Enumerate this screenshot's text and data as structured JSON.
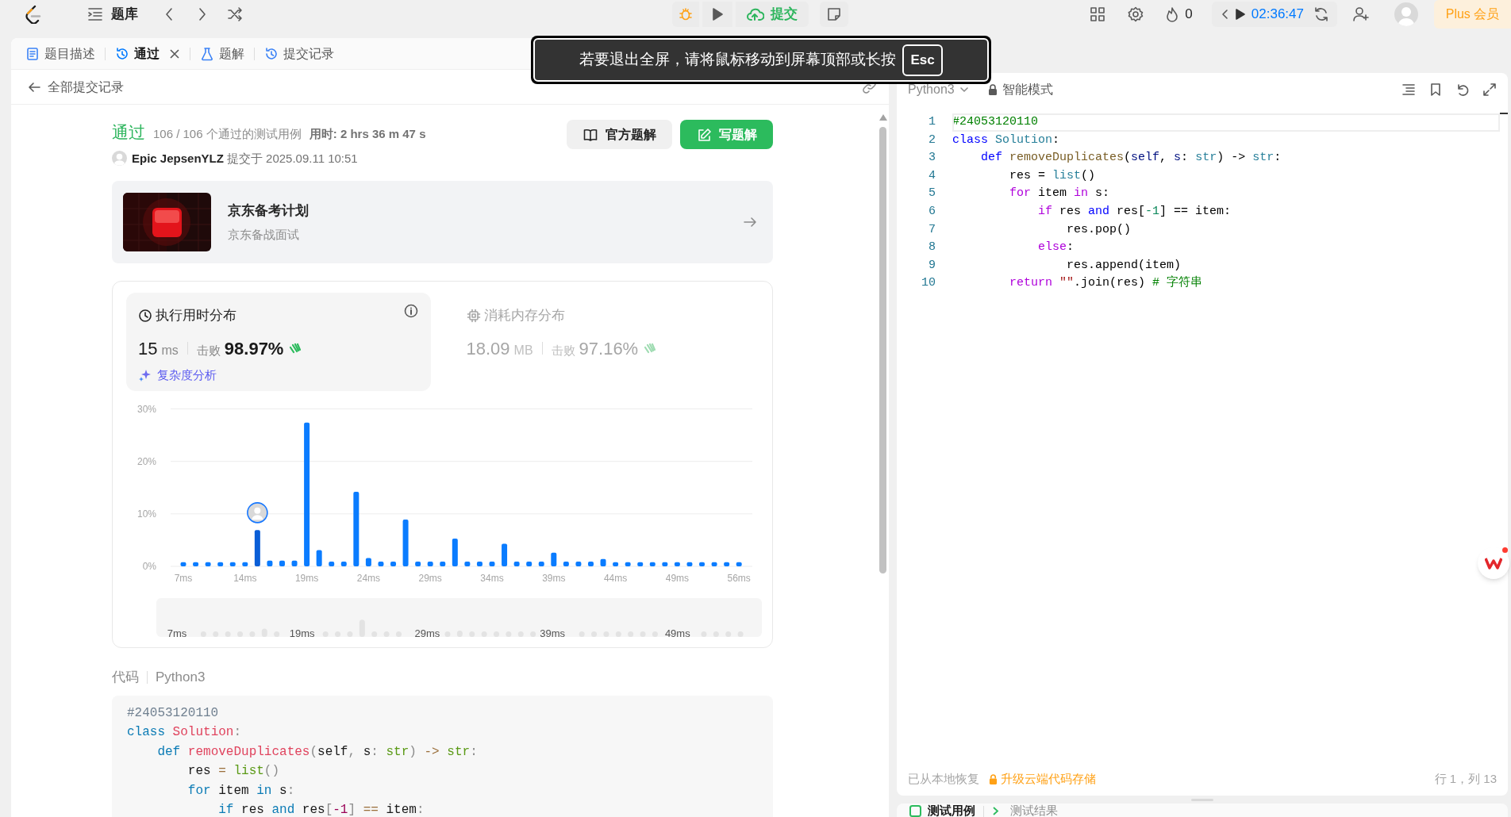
{
  "top_bar": {
    "problem_bank": "题库",
    "submit": "提交",
    "streak": "0",
    "timer": "02:36:47",
    "plus": "Plus 会员"
  },
  "fullscreen_toast": {
    "message": "若要退出全屏，请将鼠标移动到屏幕顶部或长按",
    "key": "Esc"
  },
  "left_tabs": [
    {
      "label": "题目描述",
      "selected": false,
      "closable": false,
      "kind": "description"
    },
    {
      "label": "通过",
      "selected": true,
      "closable": true,
      "kind": "result"
    },
    {
      "label": "题解",
      "selected": false,
      "closable": false,
      "kind": "solutions"
    },
    {
      "label": "提交记录",
      "selected": false,
      "closable": false,
      "kind": "history"
    }
  ],
  "back_link": "全部提交记录",
  "submission": {
    "status": "通过",
    "cases": "106 / 106 个通过的测试用例",
    "time_label": "用时: 2 hrs 36 m 47 s",
    "user": "Epic JepsenYLZ",
    "submitted": "提交于 2025.09.11 10:51",
    "buttons": [
      {
        "label": "官方题解",
        "kind": "secondary"
      },
      {
        "label": "写题解",
        "kind": "primary"
      }
    ]
  },
  "promo": {
    "title": "京东备考计划",
    "subtitle": "京东备战面试"
  },
  "stats": [
    {
      "kind": "runtime",
      "title": "执行用时分布",
      "value": "15",
      "unit": "ms",
      "beat_label": "击败",
      "beat": "98.97%",
      "selected": true,
      "link": "复杂度分析"
    },
    {
      "kind": "memory",
      "title": "消耗内存分布",
      "value": "18.09",
      "unit": "MB",
      "beat_label": "击败",
      "beat": "97.16%",
      "selected": false
    }
  ],
  "chart_data": {
    "type": "bar",
    "categories": [
      "7ms",
      null,
      null,
      null,
      null,
      "14ms",
      null,
      null,
      null,
      null,
      "19ms",
      null,
      null,
      null,
      null,
      "24ms",
      null,
      null,
      null,
      null,
      "29ms",
      null,
      null,
      null,
      null,
      "34ms",
      null,
      null,
      null,
      null,
      "39ms",
      null,
      null,
      null,
      null,
      "44ms",
      null,
      null,
      null,
      null,
      "49ms",
      null,
      null,
      null,
      null,
      "56ms"
    ],
    "stacked": true,
    "series": [
      {
        "color": "#0a7cff",
        "values": [
          0.8,
          0.8,
          0.8,
          0.8,
          0.8,
          0.8,
          null,
          1.1,
          1.1,
          1.1,
          27.4,
          3.1,
          0.9,
          0.9,
          14.2,
          1.6,
          0.9,
          0.9,
          8.9,
          0.9,
          0.9,
          0.9,
          5.3,
          0.9,
          0.9,
          0.9,
          4.3,
          0.9,
          0.9,
          0.9,
          2.6,
          0.9,
          0.9,
          0.9,
          1.4,
          0.8,
          0.8,
          0.8,
          0.8,
          0.8,
          0.8,
          0.8,
          0.8,
          0.8,
          0.8,
          0.8
        ]
      },
      {
        "color": "#0a5ed7",
        "values": [
          null,
          null,
          null,
          null,
          null,
          null,
          6.9,
          null,
          null,
          null,
          null,
          null,
          null,
          null,
          null,
          null,
          null,
          null,
          null,
          null,
          null,
          null,
          null,
          null,
          null,
          null,
          null,
          null,
          null,
          null,
          null,
          null,
          null,
          null,
          null,
          null,
          null,
          null,
          null,
          null,
          null,
          null,
          null,
          null,
          null,
          null
        ]
      }
    ],
    "ylim": [
      0,
      30
    ],
    "yticks": [
      {
        "value": 0,
        "label": "0%"
      },
      {
        "value": 10,
        "label": "10%"
      },
      {
        "value": 20,
        "label": "20%"
      },
      {
        "value": 30,
        "label": "30%"
      }
    ]
  },
  "navigator_labels": [
    "7ms",
    "19ms",
    "29ms",
    "39ms",
    "49ms"
  ],
  "code": {
    "label": "代码",
    "language": "Python3",
    "lines": [
      [
        {
          "text": "#24053120110",
          "kind": "comment"
        }
      ],
      [
        {
          "text": "class",
          "kind": "keyword"
        },
        {
          "text": " Solution",
          "kind": "name"
        },
        {
          "text": ":",
          "kind": "punct"
        }
      ],
      [
        {
          "text": "    def",
          "kind": "keyword"
        },
        {
          "text": " removeDuplicates",
          "kind": "name"
        },
        {
          "text": "(",
          "kind": "punct"
        },
        {
          "text": "self",
          "kind": "plain"
        },
        {
          "text": ",",
          "kind": "punct"
        },
        {
          "text": " s",
          "kind": "plain"
        },
        {
          "text": ":",
          "kind": "punct"
        },
        {
          "text": " str",
          "kind": "builtin"
        },
        {
          "text": ")",
          "kind": "punct"
        },
        {
          "text": " ->",
          "kind": "operator"
        },
        {
          "text": " str",
          "kind": "builtin"
        },
        {
          "text": ":",
          "kind": "punct"
        }
      ],
      [
        {
          "text": "        res ",
          "kind": "plain"
        },
        {
          "text": "=",
          "kind": "operator"
        },
        {
          "text": " list",
          "kind": "builtin"
        },
        {
          "text": "()",
          "kind": "punct"
        }
      ],
      [
        {
          "text": "        for",
          "kind": "keyword"
        },
        {
          "text": " item ",
          "kind": "plain"
        },
        {
          "text": "in",
          "kind": "keyword"
        },
        {
          "text": " s",
          "kind": "plain"
        },
        {
          "text": ":",
          "kind": "punct"
        }
      ],
      [
        {
          "text": "            if",
          "kind": "keyword"
        },
        {
          "text": " res ",
          "kind": "plain"
        },
        {
          "text": "and",
          "kind": "keyword"
        },
        {
          "text": " res",
          "kind": "plain"
        },
        {
          "text": "[",
          "kind": "punct"
        },
        {
          "text": "-1",
          "kind": "number"
        },
        {
          "text": "]",
          "kind": "punct"
        },
        {
          "text": " ==",
          "kind": "operator"
        },
        {
          "text": " item",
          "kind": "plain"
        },
        {
          "text": ":",
          "kind": "punct"
        }
      ]
    ]
  },
  "editor": {
    "language": "Python3",
    "mode": "智能模式",
    "line_numbers": [
      "1",
      "2",
      "3",
      "4",
      "5",
      "6",
      "7",
      "8",
      "9",
      "10"
    ],
    "lines": [
      [
        {
          "text": "#24053120110",
          "kind": "comment"
        }
      ],
      [
        {
          "text": "class",
          "kind": "keyword"
        },
        {
          "text": " Solution",
          "kind": "type"
        },
        {
          "text": ":",
          "kind": "plain"
        }
      ],
      [
        {
          "text": "    def",
          "kind": "keyword"
        },
        {
          "text": " removeDuplicates",
          "kind": "function"
        },
        {
          "text": "(",
          "kind": "plain"
        },
        {
          "text": "self",
          "kind": "param"
        },
        {
          "text": ", ",
          "kind": "plain"
        },
        {
          "text": "s",
          "kind": "param"
        },
        {
          "text": ": ",
          "kind": "plain"
        },
        {
          "text": "str",
          "kind": "type"
        },
        {
          "text": ") -> ",
          "kind": "plain"
        },
        {
          "text": "str",
          "kind": "type"
        },
        {
          "text": ":",
          "kind": "plain"
        }
      ],
      [
        {
          "text": "        res = ",
          "kind": "plain"
        },
        {
          "text": "list",
          "kind": "type"
        },
        {
          "text": "()",
          "kind": "plain"
        }
      ],
      [
        {
          "text": "        for",
          "kind": "control"
        },
        {
          "text": " item ",
          "kind": "plain"
        },
        {
          "text": "in",
          "kind": "control"
        },
        {
          "text": " s:",
          "kind": "plain"
        }
      ],
      [
        {
          "text": "            if",
          "kind": "control"
        },
        {
          "text": " res ",
          "kind": "plain"
        },
        {
          "text": "and",
          "kind": "keyword"
        },
        {
          "text": " res[",
          "kind": "plain"
        },
        {
          "text": "-1",
          "kind": "number"
        },
        {
          "text": "] == item:",
          "kind": "plain"
        }
      ],
      [
        {
          "text": "                res.pop()",
          "kind": "plain"
        }
      ],
      [
        {
          "text": "            else",
          "kind": "control"
        },
        {
          "text": ":",
          "kind": "plain"
        }
      ],
      [
        {
          "text": "                res.append(item)",
          "kind": "plain"
        }
      ],
      [
        {
          "text": "        return",
          "kind": "control"
        },
        {
          "text": " \"\"",
          "kind": "string"
        },
        {
          "text": ".join(res) ",
          "kind": "plain"
        },
        {
          "text": "# 字符串",
          "kind": "comment"
        }
      ]
    ],
    "status": "已从本地恢复",
    "upgrade": "升级云端代码存储",
    "cursor": "行 1，列 13"
  },
  "bottom_tabs": [
    {
      "label": "测试用例",
      "selected": true,
      "kind": "cases"
    },
    {
      "label": "测试结果",
      "selected": false,
      "kind": "results"
    }
  ]
}
